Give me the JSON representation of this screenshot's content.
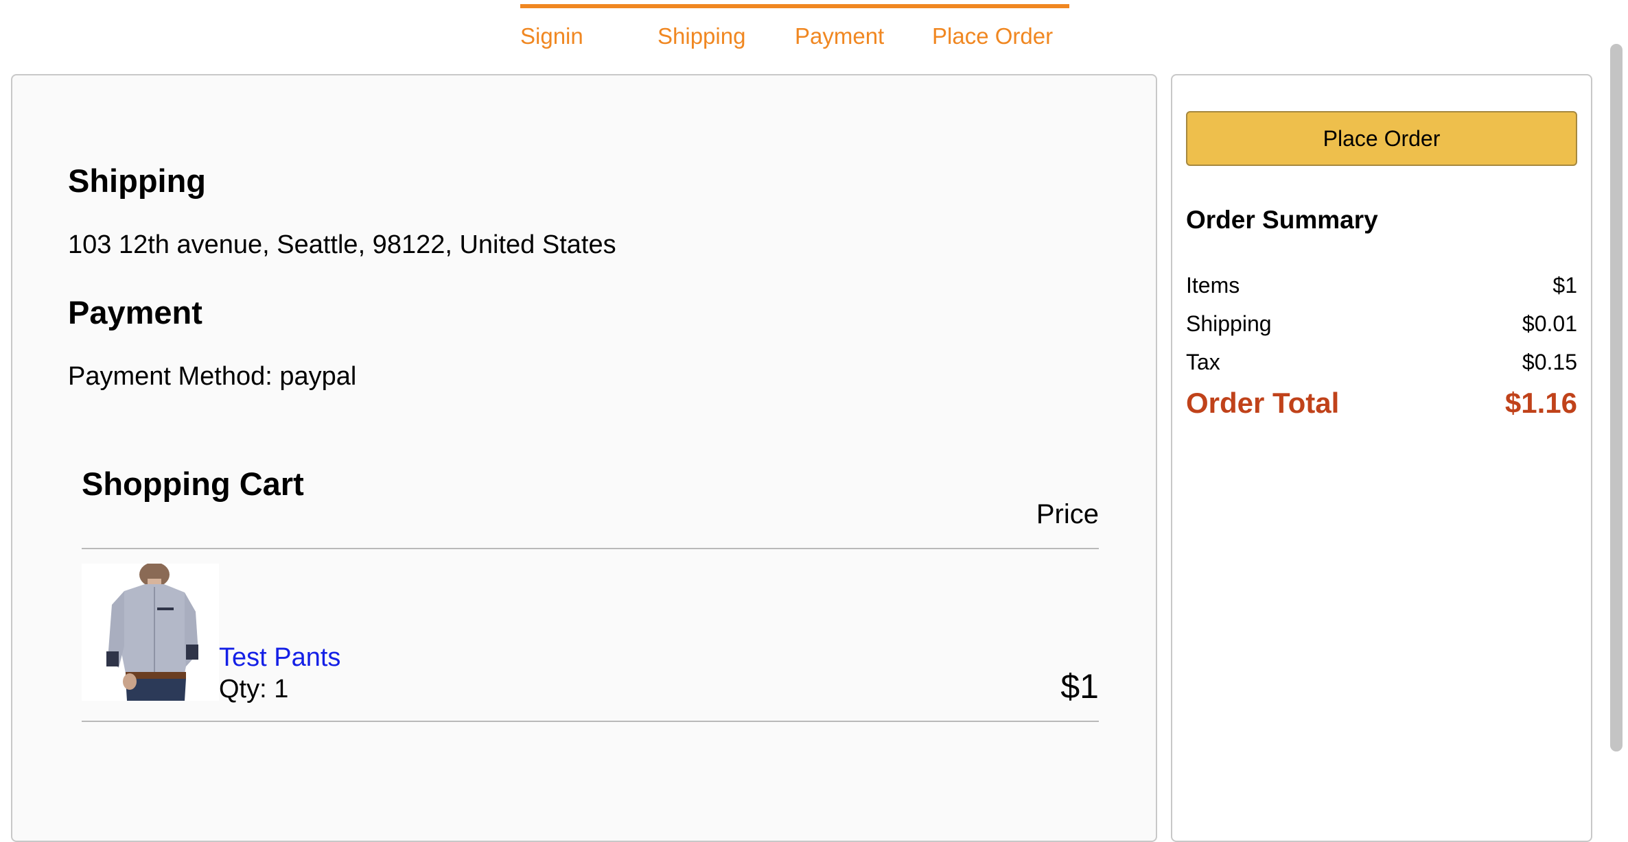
{
  "steps": {
    "signin": "Signin",
    "shipping": "Shipping",
    "payment": "Payment",
    "place_order": "Place Order"
  },
  "shipping": {
    "title": "Shipping",
    "address": "103 12th avenue, Seattle, 98122, United States"
  },
  "payment": {
    "title": "Payment",
    "method": "Payment Method: paypal"
  },
  "cart": {
    "title": "Shopping Cart",
    "price_header": "Price",
    "items": [
      {
        "name": "Test Pants",
        "qty": "Qty: 1",
        "price": "$1"
      }
    ]
  },
  "summary": {
    "button_label": "Place Order",
    "title": "Order Summary",
    "rows": [
      {
        "label": "Items",
        "value": "$1"
      },
      {
        "label": "Shipping",
        "value": "$0.01"
      },
      {
        "label": "Tax",
        "value": "$0.15"
      }
    ],
    "total": {
      "label": "Order Total",
      "value": "$1.16"
    }
  },
  "colors": {
    "accent": "#f08721",
    "button": "#eebf4c",
    "link": "#1420e6",
    "total": "#c0421a"
  },
  "icons": {
    "product_image": "shirt-photo"
  }
}
